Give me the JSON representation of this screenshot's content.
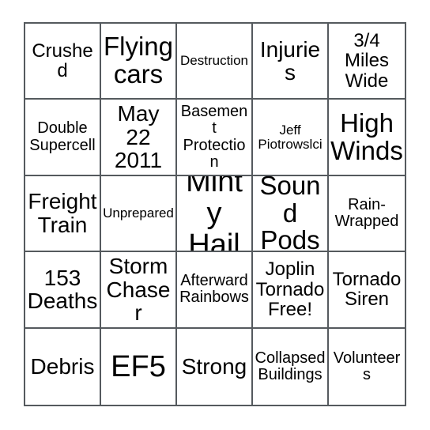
{
  "card": {
    "type": "bingo-card",
    "rows": 5,
    "columns": 5,
    "text_color": "#000000",
    "background_color": "#ffffff",
    "border_color": "#555a5e",
    "cells": [
      {
        "text": "Crushed",
        "size": "md"
      },
      {
        "text": "Flying\ncars",
        "size": "xl"
      },
      {
        "text": "Destruction",
        "size": "xs"
      },
      {
        "text": "Injuries",
        "size": "lg"
      },
      {
        "text": "3/4\nMiles\nWide",
        "size": "md"
      },
      {
        "text": "Double\nSupercell",
        "size": "sm"
      },
      {
        "text": "May 22\n2011",
        "size": "lg"
      },
      {
        "text": "Basement\nProtection",
        "size": "sm"
      },
      {
        "text": "Jeff\nPiotrowslci",
        "size": "xs"
      },
      {
        "text": "High\nWinds",
        "size": "xl"
      },
      {
        "text": "Freight\nTrain",
        "size": "lg"
      },
      {
        "text": "Unprepared",
        "size": "xs"
      },
      {
        "text": "Minty\nHail",
        "size": "xxl"
      },
      {
        "text": "Sound\nPods",
        "size": "xl"
      },
      {
        "text": "Rain-\nWrapped",
        "size": "sm"
      },
      {
        "text": "153\nDeaths",
        "size": "lg"
      },
      {
        "text": "Storm\nChaser",
        "size": "lg"
      },
      {
        "text": "Afterward\nRainbows",
        "size": "sm"
      },
      {
        "text": "Joplin\nTornado\nFree!",
        "size": "md"
      },
      {
        "text": "Tornado\nSiren",
        "size": "md"
      },
      {
        "text": "Debris",
        "size": "lg"
      },
      {
        "text": "EF5",
        "size": "xxl"
      },
      {
        "text": "Strong",
        "size": "lg"
      },
      {
        "text": "Collapsed\nBuildings",
        "size": "sm"
      },
      {
        "text": "Volunteers",
        "size": "sm"
      }
    ]
  }
}
